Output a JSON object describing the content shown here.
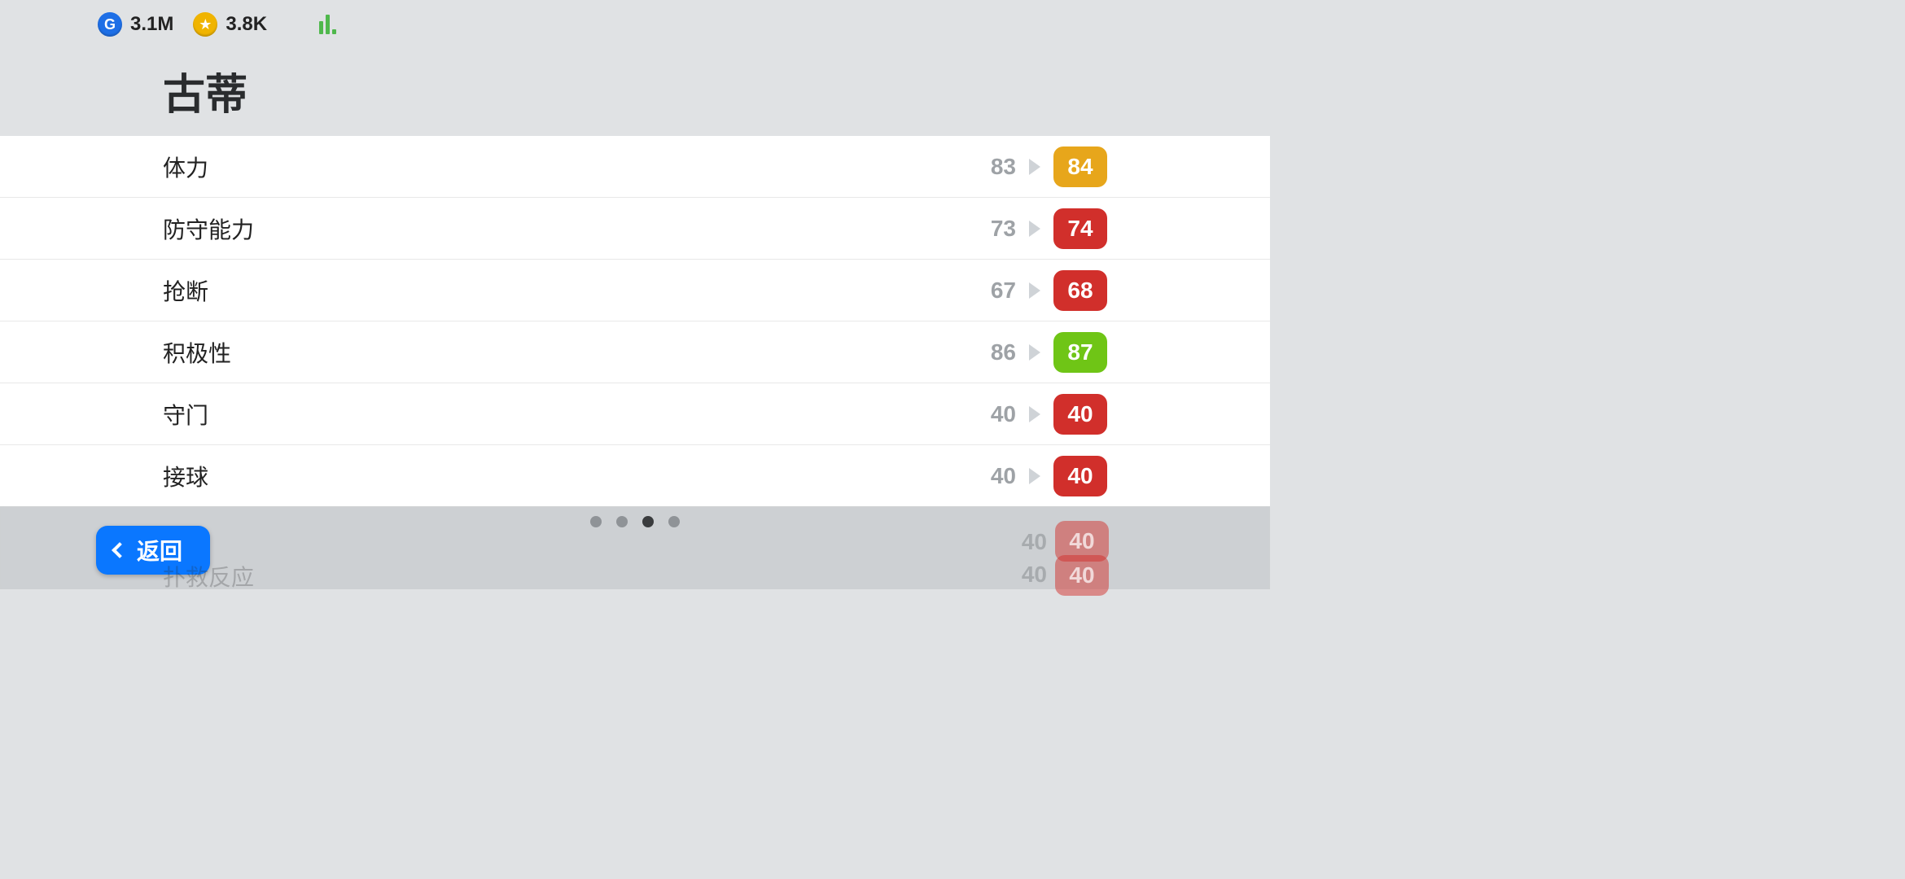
{
  "currencies": {
    "g_label": "G",
    "g_value": "3.1M",
    "star_value": "3.8K"
  },
  "player_name": "古蒂",
  "stats": [
    {
      "label": "体力",
      "old": "83",
      "new": "84",
      "color": "orange"
    },
    {
      "label": "防守能力",
      "old": "73",
      "new": "74",
      "color": "red"
    },
    {
      "label": "抢断",
      "old": "67",
      "new": "68",
      "color": "red"
    },
    {
      "label": "积极性",
      "old": "86",
      "new": "87",
      "color": "green"
    },
    {
      "label": "守门",
      "old": "40",
      "new": "40",
      "color": "red"
    },
    {
      "label": "接球",
      "old": "40",
      "new": "40",
      "color": "red"
    }
  ],
  "pager": {
    "count": 4,
    "active_index": 2
  },
  "back_label": "返回",
  "ghost": {
    "row1_old": "40",
    "row1_new": "40",
    "row2_label": "扑救反应",
    "row2_old": "40",
    "row2_new": "40"
  }
}
